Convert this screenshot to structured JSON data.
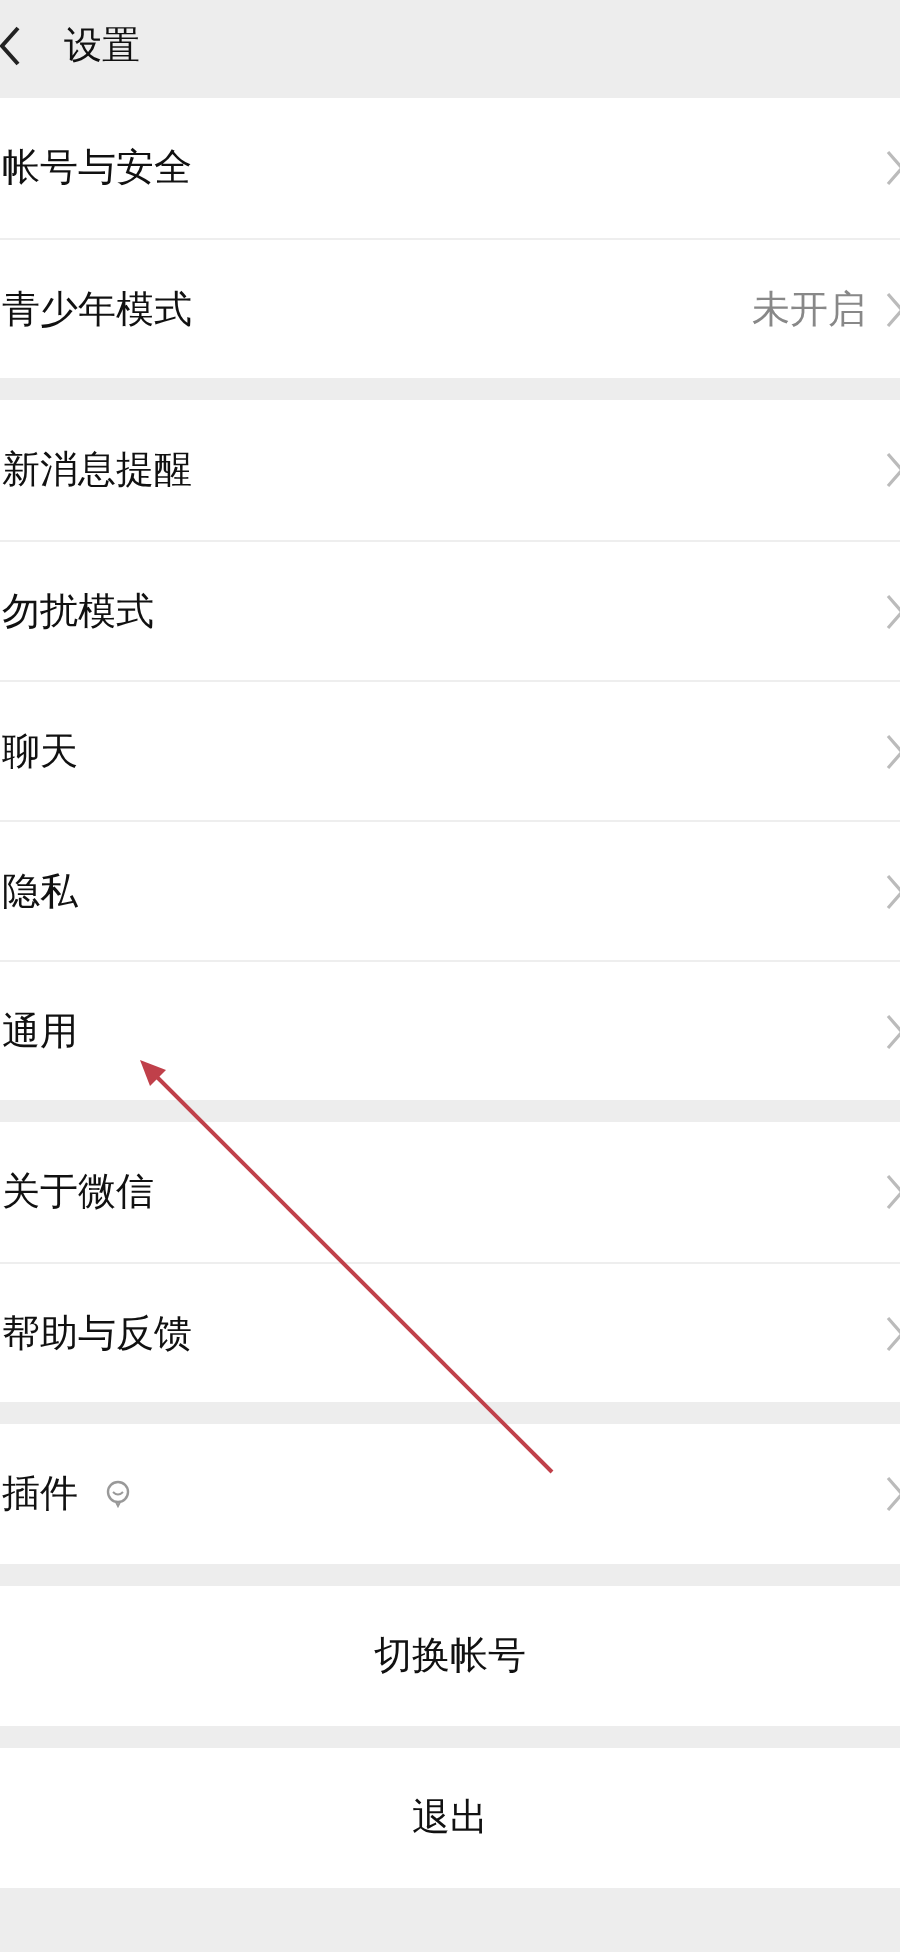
{
  "header": {
    "title": "设置"
  },
  "groups": [
    {
      "items": [
        {
          "label": "帐号与安全"
        },
        {
          "label": "青少年模式",
          "value": "未开启"
        }
      ]
    },
    {
      "items": [
        {
          "label": "新消息提醒"
        },
        {
          "label": "勿扰模式"
        },
        {
          "label": "聊天"
        },
        {
          "label": "隐私"
        },
        {
          "label": "通用"
        }
      ]
    },
    {
      "items": [
        {
          "label": "关于微信"
        },
        {
          "label": "帮助与反馈"
        }
      ]
    },
    {
      "items": [
        {
          "label": "插件",
          "badge": true
        }
      ]
    }
  ],
  "buttons": [
    "切换帐号",
    "退出"
  ]
}
